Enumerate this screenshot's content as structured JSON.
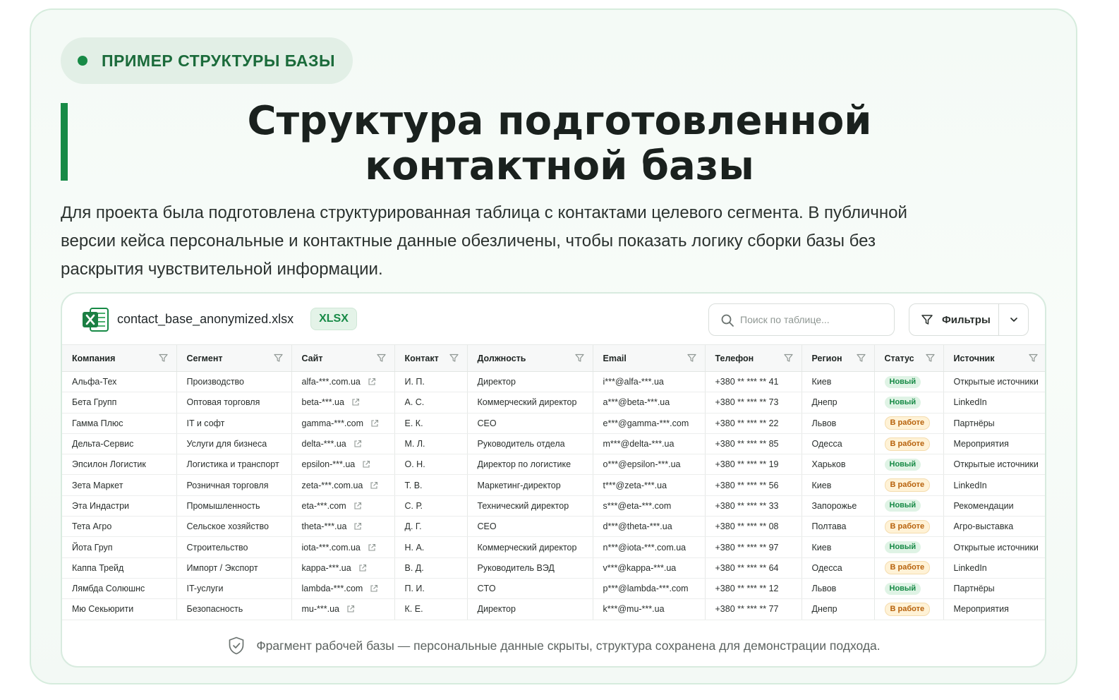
{
  "badge": {
    "label": "ПРИМЕР СТРУКТУРЫ БАЗЫ"
  },
  "title": {
    "line1": "Структура подготовленной",
    "line2": "контактной базы"
  },
  "description": "Для проекта была подготовлена структурированная таблица с контактами целевого сегмента. В публичной версии кейса персональные и контактные данные обезличены, чтобы показать логику сборки базы без раскрытия чувствительной информации.",
  "file": {
    "name": "contact_base_anonymized.xlsx",
    "format": "XLSX",
    "icon": "excel-icon"
  },
  "search": {
    "placeholder": "Поиск по таблице...",
    "icon": "search-icon"
  },
  "filters": {
    "label": "Фильтры",
    "icon": "filter-icon",
    "toggle_icon": "chevron-down-icon"
  },
  "table": {
    "columns": [
      "Компания",
      "Сегмент",
      "Сайт",
      "Контакт",
      "Должность",
      "Email",
      "Телефон",
      "Регион",
      "Статус",
      "Источник"
    ],
    "rows": [
      {
        "company": "Альфа-Тех",
        "segment": "Производство",
        "site": "alfa-***.com.ua",
        "contact": "И. П.",
        "position": "Директор",
        "email": "i***@alfa-***.ua",
        "phone": "+380 ** *** ** 41",
        "region": "Киев",
        "status": "Новый",
        "status_type": "new",
        "source": "Открытые источники"
      },
      {
        "company": "Бета Групп",
        "segment": "Оптовая торговля",
        "site": "beta-***.ua",
        "contact": "А. С.",
        "position": "Коммерческий директор",
        "email": "a***@beta-***.ua",
        "phone": "+380 ** *** ** 73",
        "region": "Днепр",
        "status": "Новый",
        "status_type": "new",
        "source": "LinkedIn"
      },
      {
        "company": "Гамма Плюс",
        "segment": "IT и софт",
        "site": "gamma-***.com",
        "contact": "Е. К.",
        "position": "CEO",
        "email": "e***@gamma-***.com",
        "phone": "+380 ** *** ** 22",
        "region": "Львов",
        "status": "В работе",
        "status_type": "work",
        "source": "Партнёры"
      },
      {
        "company": "Дельта-Сервис",
        "segment": "Услуги для бизнеса",
        "site": "delta-***.ua",
        "contact": "М. Л.",
        "position": "Руководитель отдела",
        "email": "m***@delta-***.ua",
        "phone": "+380 ** *** ** 85",
        "region": "Одесса",
        "status": "В работе",
        "status_type": "work",
        "source": "Мероприятия"
      },
      {
        "company": "Эпсилон Логистик",
        "segment": "Логистика и транспорт",
        "site": "epsilon-***.ua",
        "contact": "О. Н.",
        "position": "Директор по логистике",
        "email": "o***@epsilon-***.ua",
        "phone": "+380 ** *** ** 19",
        "region": "Харьков",
        "status": "Новый",
        "status_type": "new",
        "source": "Открытые источники"
      },
      {
        "company": "Зета Маркет",
        "segment": "Розничная торговля",
        "site": "zeta-***.com.ua",
        "contact": "Т. В.",
        "position": "Маркетинг-директор",
        "email": "t***@zeta-***.ua",
        "phone": "+380 ** *** ** 56",
        "region": "Киев",
        "status": "В работе",
        "status_type": "work",
        "source": "LinkedIn"
      },
      {
        "company": "Эта Индастри",
        "segment": "Промышленность",
        "site": "eta-***.com",
        "contact": "С. Р.",
        "position": "Технический директор",
        "email": "s***@eta-***.com",
        "phone": "+380 ** *** ** 33",
        "region": "Запорожье",
        "status": "Новый",
        "status_type": "new",
        "source": "Рекомендации"
      },
      {
        "company": "Тета Агро",
        "segment": "Сельское хозяйство",
        "site": "theta-***.ua",
        "contact": "Д. Г.",
        "position": "CEO",
        "email": "d***@theta-***.ua",
        "phone": "+380 ** *** ** 08",
        "region": "Полтава",
        "status": "В работе",
        "status_type": "work",
        "source": "Агро-выставка"
      },
      {
        "company": "Йота Груп",
        "segment": "Строительство",
        "site": "iota-***.com.ua",
        "contact": "Н. А.",
        "position": "Коммерческий директор",
        "email": "n***@iota-***.com.ua",
        "phone": "+380 ** *** ** 97",
        "region": "Киев",
        "status": "Новый",
        "status_type": "new",
        "source": "Открытые источники"
      },
      {
        "company": "Каппа Трейд",
        "segment": "Импорт / Экспорт",
        "site": "kappa-***.ua",
        "contact": "В. Д.",
        "position": "Руководитель ВЭД",
        "email": "v***@kappa-***.ua",
        "phone": "+380 ** *** ** 64",
        "region": "Одесса",
        "status": "В работе",
        "status_type": "work",
        "source": "LinkedIn"
      },
      {
        "company": "Лямбда Солюшнс",
        "segment": "IT-услуги",
        "site": "lambda-***.com",
        "contact": "П. И.",
        "position": "CTO",
        "email": "p***@lambda-***.com",
        "phone": "+380 ** *** ** 12",
        "region": "Львов",
        "status": "Новый",
        "status_type": "new",
        "source": "Партнёры"
      },
      {
        "company": "Мю Секьюрити",
        "segment": "Безопасность",
        "site": "mu-***.ua",
        "contact": "К. Е.",
        "position": "Директор",
        "email": "k***@mu-***.ua",
        "phone": "+380 ** *** ** 77",
        "region": "Днепр",
        "status": "В работе",
        "status_type": "work",
        "source": "Мероприятия"
      }
    ]
  },
  "footnote": {
    "text": "Фрагмент рабочей базы — персональные данные скрыты, структура сохранена для демонстрации подхода.",
    "icon": "shield-check-icon"
  },
  "colors": {
    "accent": "#178a46",
    "status_new_bg": "#dff3e5",
    "status_work_bg": "#fff2d6",
    "status_work_text": "#b7620c"
  }
}
